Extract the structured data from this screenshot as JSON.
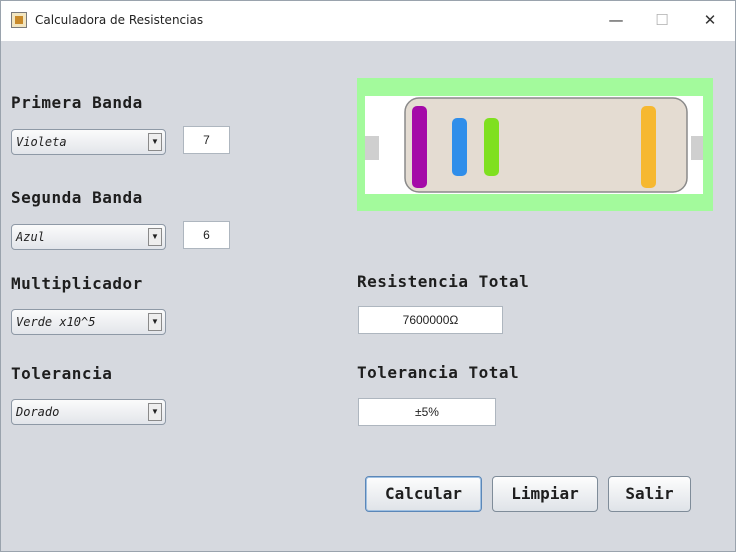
{
  "window": {
    "title": "Calculadora de Resistencias",
    "controls": {
      "minimize": "—",
      "maximize": "☐",
      "close": "✕"
    }
  },
  "bands": {
    "first": {
      "label": "Primera Banda",
      "selected": "Violeta",
      "value": "7"
    },
    "second": {
      "label": "Segunda Banda",
      "selected": "Azul",
      "value": "6"
    },
    "multiplier": {
      "label": "Multiplicador",
      "selected": "Verde x10^5"
    },
    "tolerance": {
      "label": "Tolerancia",
      "selected": "Dorado"
    }
  },
  "results": {
    "resistance_label": "Resistencia Total",
    "resistance_value": "7600000Ω",
    "tolerance_label": "Tolerancia Total",
    "tolerance_value": "±5%"
  },
  "buttons": {
    "calculate": "Calcular",
    "clear": "Limpiar",
    "exit": "Salir"
  },
  "resistor_colors": {
    "background": "#a3fa9c",
    "band1": "#a40aa8",
    "band2": "#2f8eea",
    "band3": "#7fe020",
    "band4": "#f6b830"
  }
}
